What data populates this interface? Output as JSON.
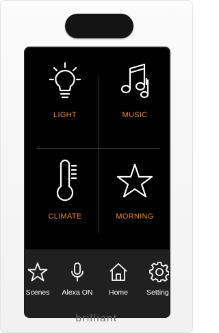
{
  "tiles": [
    {
      "label": "LIGHT",
      "icon": "lightbulb-icon"
    },
    {
      "label": "MUSIC",
      "icon": "music-notes-icon"
    },
    {
      "label": "CLIMATE",
      "icon": "thermometer-icon"
    },
    {
      "label": "MORNING",
      "icon": "star-icon"
    }
  ],
  "nav": [
    {
      "label": "Scenes",
      "icon": "star-outline-icon"
    },
    {
      "label": "Alexa ON",
      "icon": "microphone-icon"
    },
    {
      "label": "Home",
      "icon": "home-icon"
    },
    {
      "label": "Settings",
      "icon": "gear-icon"
    }
  ],
  "brand": "brilliant",
  "colors": {
    "accent": "#f28a21",
    "screen": "#000000",
    "nav_bar": "#202020"
  }
}
